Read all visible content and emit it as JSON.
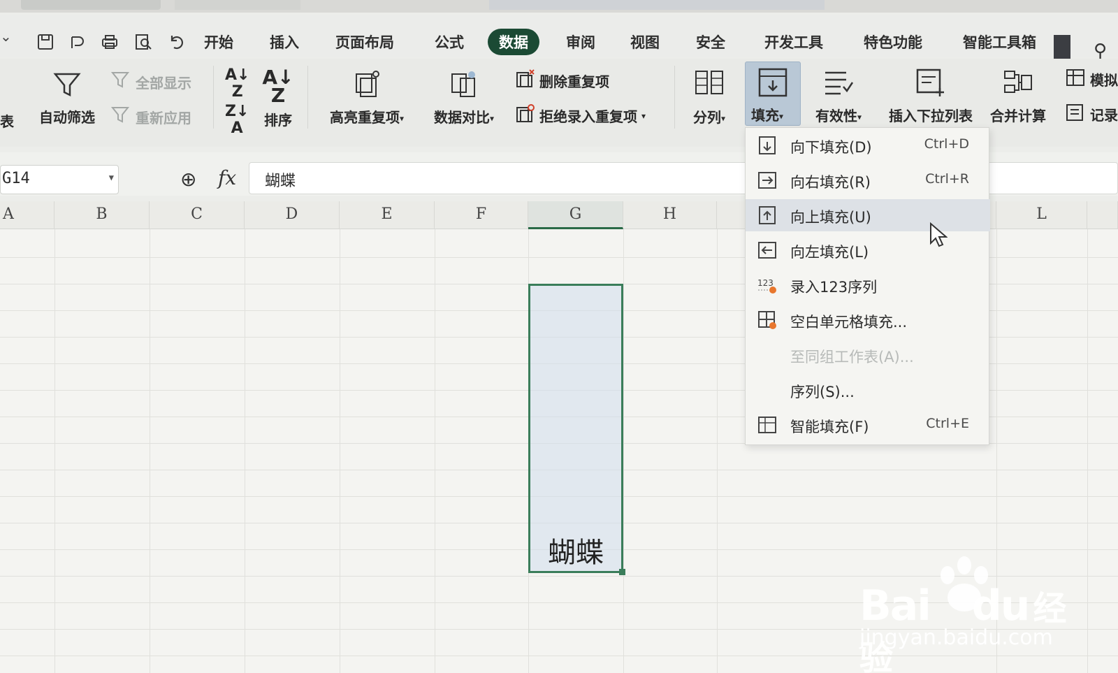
{
  "menu": {
    "tabs": [
      "开始",
      "插入",
      "页面布局",
      "公式",
      "数据",
      "审阅",
      "视图",
      "安全",
      "开发工具",
      "特色功能",
      "智能工具箱"
    ],
    "active_tab": "数据"
  },
  "ribbon": {
    "table_partial": "表",
    "auto_filter": "自动筛选",
    "show_all": "全部显示",
    "reapply": "重新应用",
    "sort": "排序",
    "highlight_dup": "高亮重复项",
    "data_compare": "数据对比",
    "remove_dup": "删除重复项",
    "reject_dup": "拒绝录入重复项",
    "split_col": "分列",
    "fill": "填充",
    "validity": "有效性",
    "insert_dropdown": "插入下拉列表",
    "merge_calc": "合并计算",
    "simulate_partial": "模拟",
    "record_partial": "记录"
  },
  "formula_bar": {
    "cell_ref": "G14",
    "content": "蝴蝶"
  },
  "grid": {
    "columns": [
      "A",
      "B",
      "C",
      "D",
      "E",
      "F",
      "G",
      "H",
      "L"
    ],
    "selected_column": "G",
    "cell_value": "蝴蝶"
  },
  "fill_menu": {
    "items": [
      {
        "label": "向下填充(D)",
        "shortcut": "Ctrl+D"
      },
      {
        "label": "向右填充(R)",
        "shortcut": "Ctrl+R"
      },
      {
        "label": "向上填充(U)",
        "shortcut": ""
      },
      {
        "label": "向左填充(L)",
        "shortcut": ""
      },
      {
        "label": "录入123序列",
        "shortcut": ""
      },
      {
        "label": "空白单元格填充...",
        "shortcut": ""
      },
      {
        "label": "至同组工作表(A)...",
        "shortcut": ""
      },
      {
        "label": "序列(S)...",
        "shortcut": ""
      },
      {
        "label": "智能填充(F)",
        "shortcut": "Ctrl+E"
      }
    ],
    "hovered": "向上填充(U)"
  },
  "watermark": {
    "brand": "Bai",
    "brand_du": "du",
    "brand_cn": "经验",
    "url": "jingyan.baidu.com"
  },
  "colors": {
    "active_tab_bg": "#1b4a34",
    "selection_border": "#3a7d5a",
    "fill_button_bg": "#b9c8d6"
  }
}
